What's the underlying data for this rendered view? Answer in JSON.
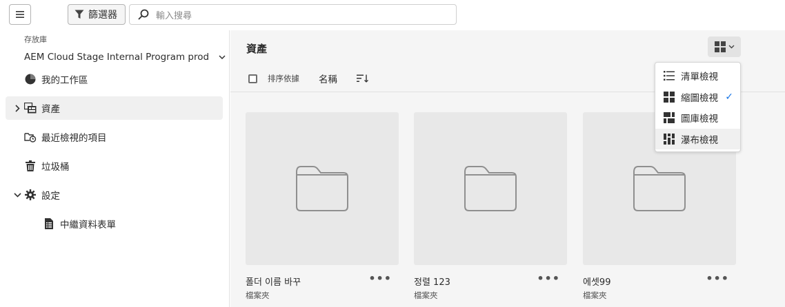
{
  "topbar": {
    "filter_label": "篩選器",
    "search_placeholder": "輸入搜尋"
  },
  "sidebar": {
    "repo_label": "存放庫",
    "repo_value": "AEM Cloud Stage Internal Program prod",
    "items": [
      {
        "label": "我的工作區",
        "icon": "workspace-icon"
      },
      {
        "label": "資產",
        "icon": "assets-icon",
        "selected": true
      },
      {
        "label": "最近檢視的項目",
        "icon": "recent-icon"
      },
      {
        "label": "垃圾桶",
        "icon": "trash-icon"
      },
      {
        "label": "設定",
        "icon": "gear-icon"
      },
      {
        "label": "中繼資料表單",
        "icon": "form-icon"
      }
    ]
  },
  "main": {
    "title": "資產",
    "sort_label": "排序依據",
    "sort_field": "名稱",
    "cards": [
      {
        "title": "폴더 이름 바꾸",
        "type": "檔案夾"
      },
      {
        "title": "정렬 123",
        "type": "檔案夾"
      },
      {
        "title": "에셋99",
        "type": "檔案夾"
      }
    ]
  },
  "view_menu": {
    "items": [
      {
        "label": "清單檢視"
      },
      {
        "label": "縮圖檢視",
        "checked": true
      },
      {
        "label": "圖庫檢視"
      },
      {
        "label": "瀑布檢視"
      }
    ]
  },
  "colors": {
    "accent": "#1473e6",
    "main_bg": "#f5f5f5",
    "thumb_bg": "#e8e8e8"
  }
}
